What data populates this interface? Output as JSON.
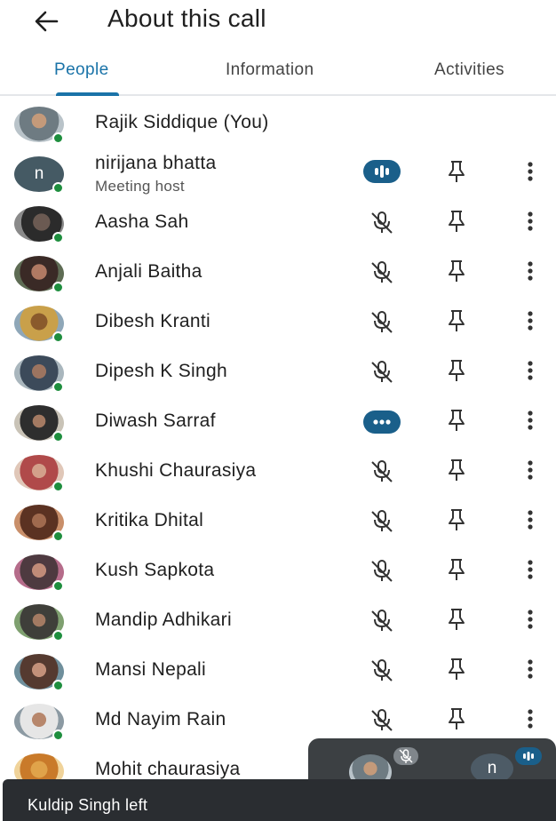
{
  "header": {
    "title": "About this call"
  },
  "tabs": [
    {
      "label": "People",
      "active": true
    },
    {
      "label": "Information",
      "active": false
    },
    {
      "label": "Activities",
      "active": false
    }
  ],
  "participants": [
    {
      "name": "Rajik Siddique (You)",
      "avatar": "photo"
    },
    {
      "name": "nirijana bhatta",
      "subtitle": "Meeting host",
      "avatar_letter": "n",
      "audio": "speaking"
    },
    {
      "name": "Aasha Sah",
      "audio": "muted"
    },
    {
      "name": "Anjali Baitha",
      "audio": "muted"
    },
    {
      "name": "Dibesh Kranti",
      "audio": "muted"
    },
    {
      "name": "Dipesh K Singh",
      "audio": "muted"
    },
    {
      "name": "Diwash Sarraf",
      "audio": "active"
    },
    {
      "name": "Khushi Chaurasiya",
      "audio": "muted"
    },
    {
      "name": "Kritika Dhital",
      "audio": "muted"
    },
    {
      "name": "Kush Sapkota",
      "audio": "muted"
    },
    {
      "name": "Mandip Adhikari",
      "audio": "muted"
    },
    {
      "name": "Mansi Nepali",
      "audio": "muted"
    },
    {
      "name": "Md Nayim Rain",
      "audio": "muted"
    },
    {
      "name": "Mohit chaurasiya"
    }
  ],
  "pip": {
    "tile2_letter": "n"
  },
  "toast": {
    "text": "Kuldip Singh left"
  },
  "colors": {
    "accent": "#1a73a8",
    "online": "#1e8e3e",
    "speaking": "#1a5f8a"
  },
  "icons": [
    "back-arrow-icon",
    "mic-off-icon",
    "pin-icon",
    "more-vert-icon",
    "speaking-indicator-icon"
  ]
}
